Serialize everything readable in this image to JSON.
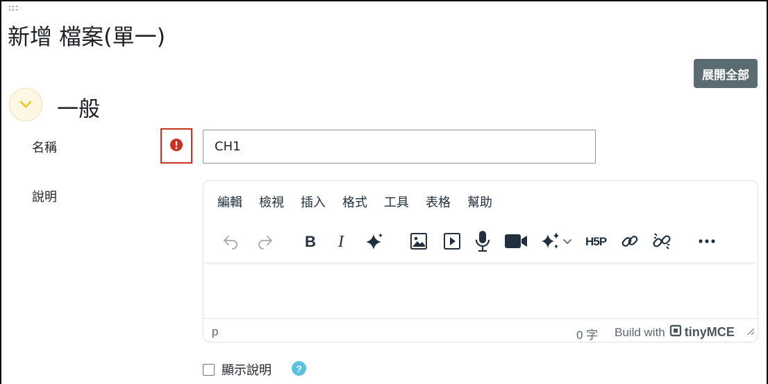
{
  "page": {
    "drag_handle": ":::",
    "title": "新增 檔案(單一)",
    "expand_all_label": "展開全部"
  },
  "section": {
    "title": "一般",
    "toggle_icon": "chevron-down-icon"
  },
  "form": {
    "name_label": "名稱",
    "name_value": "CH1",
    "required_icon": "exclamation-circle-icon",
    "description_label": "說明",
    "show_description_label": "顯示說明",
    "show_description_checked": false,
    "help_icon_text": "?"
  },
  "editor": {
    "menu": [
      "編輯",
      "檢視",
      "插入",
      "格式",
      "工具",
      "表格",
      "幫助"
    ],
    "toolbar": [
      "undo-icon",
      "redo-icon",
      "bold-icon",
      "italic-icon",
      "ai-sparkle-icon",
      "image-icon",
      "media-icon",
      "microphone-icon",
      "video-camera-icon",
      "ai-stars-dropdown-icon",
      "h5p-icon",
      "link-icon",
      "unlink-icon",
      "more-icon"
    ],
    "status_path": "p",
    "word_count": "0 字",
    "build_with": "Build with",
    "brand": "tinyMCE"
  },
  "colors": {
    "accent_button": "#5a6b72",
    "required_red": "#ca3120",
    "toggle_bg": "#fdf7e3",
    "chevron": "#f0c419",
    "help_blue": "#5bc0de"
  }
}
